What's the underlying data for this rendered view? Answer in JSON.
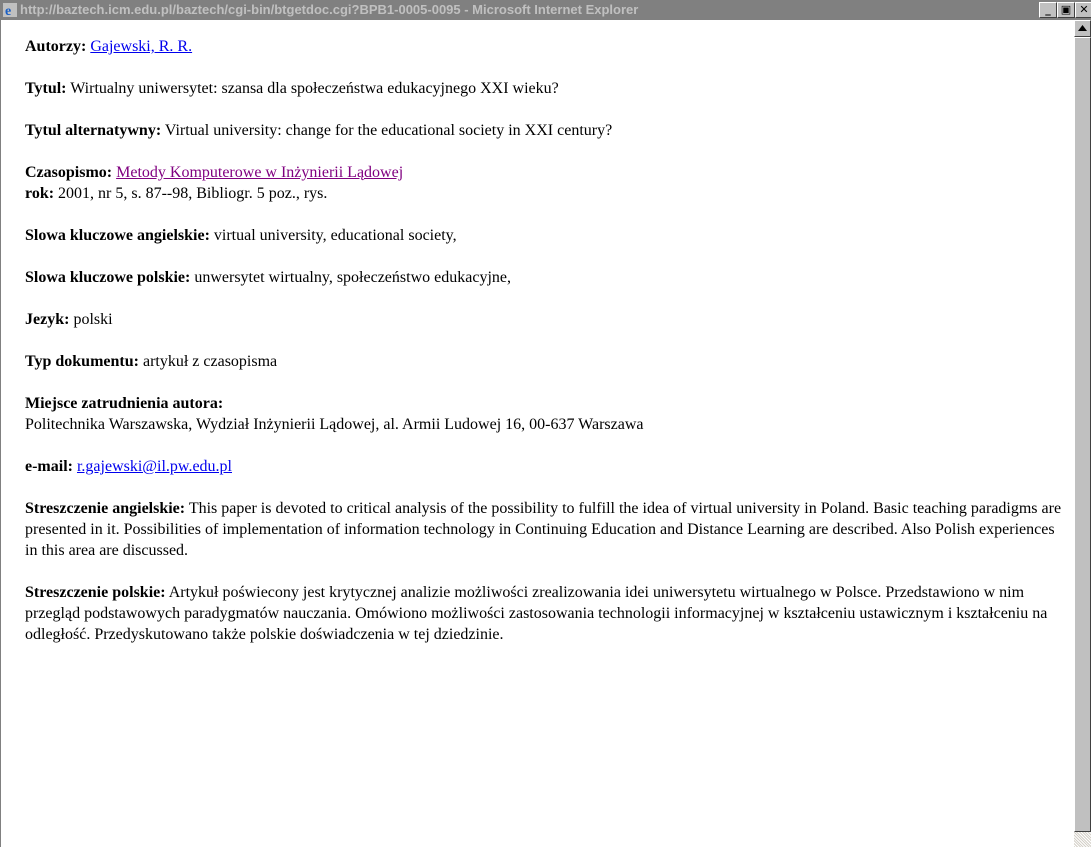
{
  "window": {
    "title": "http://baztech.icm.edu.pl/baztech/cgi-bin/btgetdoc.cgi?BPB1-0005-0095 - Microsoft Internet Explorer",
    "minimize_glyph": "_",
    "maximize_glyph": "▣",
    "close_glyph": "✕"
  },
  "record": {
    "authors_label": "Autorzy:",
    "authors_value": "Gajewski, R. R.",
    "title_label": "Tytul:",
    "title_value": "Wirtualny uniwersytet: szansa dla społeczeństwa edukacyjnego XXI wieku?",
    "alt_title_label": "Tytul alternatywny:",
    "alt_title_value": "Virtual university: change for the educational society in XXI century?",
    "journal_label": "Czasopismo:",
    "journal_value": "Metody Komputerowe w Inżynierii Lądowej",
    "year_label": "rok:",
    "year_value": "2001, nr 5, s. 87--98, Bibliogr. 5 poz., rys.",
    "kw_en_label": "Slowa kluczowe angielskie:",
    "kw_en_value": "virtual university, educational society,",
    "kw_pl_label": "Slowa kluczowe polskie:",
    "kw_pl_value": "unwersytet wirtualny, społeczeństwo edukacyjne,",
    "lang_label": "Jezyk:",
    "lang_value": "polski",
    "doctype_label": "Typ dokumentu:",
    "doctype_value": "artykuł z czasopisma",
    "affil_label": "Miejsce zatrudnienia autora:",
    "affil_value": "Politechnika Warszawska, Wydział Inżynierii Lądowej, al. Armii Ludowej 16, 00-637 Warszawa",
    "email_label": "e-mail:",
    "email_value": "r.gajewski@il.pw.edu.pl",
    "abs_en_label": "Streszczenie angielskie:",
    "abs_en_value": "This paper is devoted to critical analysis of the possibility to fulfill the idea of virtual university in Poland. Basic teaching paradigms are presented in it. Possibilities of implementation of information technology in Continuing Education and Distance Learning are described. Also Polish experiences in this area are discussed.",
    "abs_pl_label": "Streszczenie polskie:",
    "abs_pl_value": "Artykuł poświecony jest krytycznej analizie możliwości zrealizowania idei uniwersytetu wirtualnego w Polsce. Przedstawiono w nim przegląd podstawowych paradygmatów nauczania. Omówiono możliwości zastosowania technologii informacyjnej w kształceniu ustawicznym i kształceniu na odległość. Przedyskutowano także polskie doświadczenia w tej dziedzinie."
  },
  "colors": {
    "link": "#0000ee",
    "visited_link": "#800080",
    "titlebar_inactive": "#808080"
  }
}
